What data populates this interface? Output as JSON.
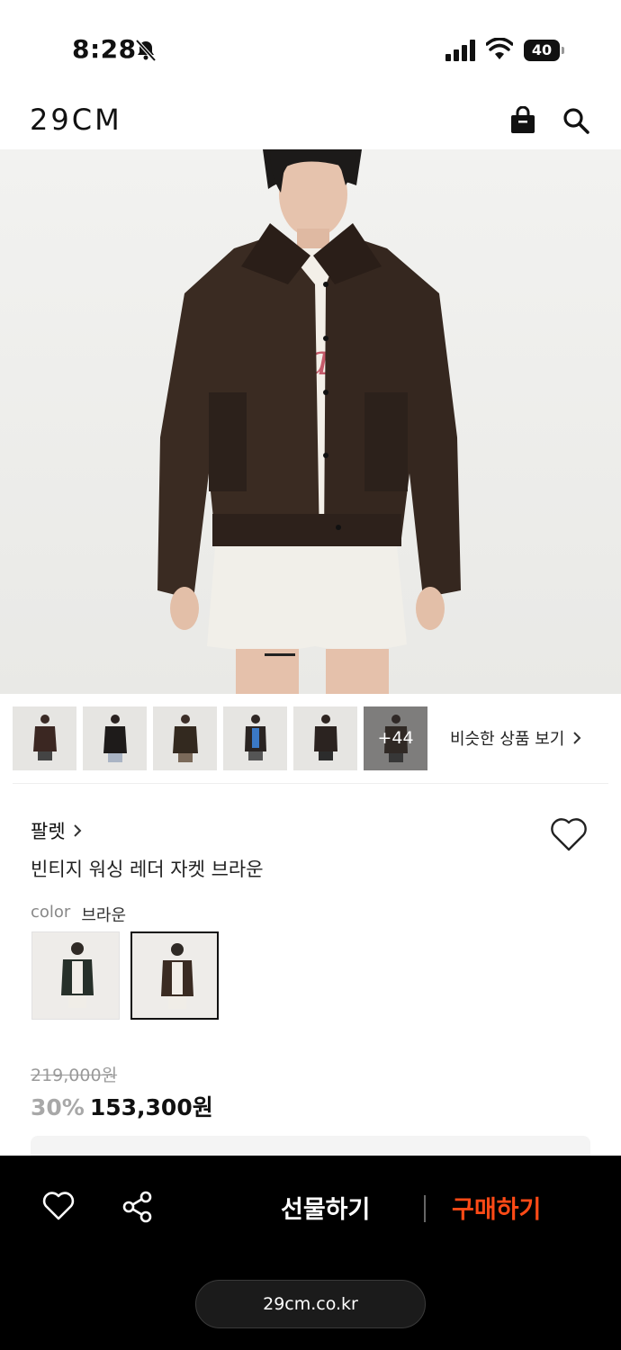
{
  "status": {
    "time": "8:28",
    "battery": "40"
  },
  "header": {
    "logo": "29CM"
  },
  "gallery": {
    "more_count": "+44",
    "similar_link": "비슷한 상품 보기"
  },
  "product": {
    "brand": "팔렛",
    "name": "빈티지 워싱 레더 자켓 브라운",
    "color_label": "color",
    "color_value": "브라운",
    "original_price": "219,000원",
    "discount": "30%",
    "final_price": "153,300원"
  },
  "bottom": {
    "gift_label": "선물하기",
    "buy_label": "구매하기",
    "url": "29cm.co.kr"
  },
  "colors": {
    "accent": "#ff4a16",
    "bottom_bar": "#000000"
  }
}
